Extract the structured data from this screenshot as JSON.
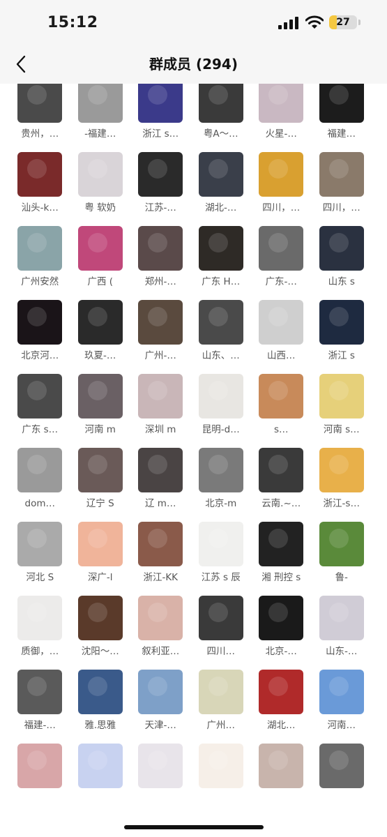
{
  "status_bar": {
    "time": "15:12",
    "battery": "27",
    "battery_level": 0.27,
    "icons": [
      "cellular-signal-icon",
      "wifi-icon",
      "battery-charging-icon"
    ]
  },
  "nav": {
    "title": "群成员 (294)",
    "back_icon": "chevron-left-icon"
  },
  "colors": {
    "nav_bg": "#f6f6f6",
    "name_text": "#555555",
    "battery_fill": "#f5c842"
  },
  "members": [
    {
      "name": "贵州，…",
      "color": "#4a4a4a"
    },
    {
      "name": "-福建…",
      "color": "#9a9a9a"
    },
    {
      "name": "浙江 s…",
      "color": "#3b3a8a"
    },
    {
      "name": "粤A～…",
      "color": "#3a3a3a"
    },
    {
      "name": "火星-…",
      "color": "#c9b8c2"
    },
    {
      "name": "福建…",
      "color": "#1c1c1c"
    },
    {
      "name": "汕头-k…",
      "color": "#7a2a2a"
    },
    {
      "name": "粤 软奶",
      "color": "#d9d4d8"
    },
    {
      "name": "江苏-…",
      "color": "#2a2a2a"
    },
    {
      "name": "湖北-…",
      "color": "#3a3f4a"
    },
    {
      "name": "四川，…",
      "color": "#d9a030"
    },
    {
      "name": "四川，…",
      "color": "#8a7a6a"
    },
    {
      "name": "广州安然",
      "color": "#8aa4a8"
    },
    {
      "name": "广西 (",
      "color": "#c0487a"
    },
    {
      "name": "郑州-…",
      "color": "#5a4a4a"
    },
    {
      "name": "广东 H…",
      "color": "#2e2a26"
    },
    {
      "name": "广东-…",
      "color": "#6a6a6a"
    },
    {
      "name": "山东 s",
      "color": "#2a3140"
    },
    {
      "name": "北京河…",
      "color": "#1a1418"
    },
    {
      "name": "玖夏-…",
      "color": "#2a2a2a"
    },
    {
      "name": "广州-…",
      "color": "#5a4a3e"
    },
    {
      "name": "山东、…",
      "color": "#4a4a4a"
    },
    {
      "name": "山西…",
      "color": "#cfcfcf"
    },
    {
      "name": "浙江 s",
      "color": "#1e2a40"
    },
    {
      "name": "广东 s…",
      "color": "#4a4a4a"
    },
    {
      "name": "河南 m",
      "color": "#6a6064"
    },
    {
      "name": "深圳 m",
      "color": "#c9b6b8"
    },
    {
      "name": "昆明-d…",
      "color": "#e8e6e2"
    },
    {
      "name": "s…",
      "color": "#c88a5a"
    },
    {
      "name": "河南 s…",
      "color": "#e6d07a"
    },
    {
      "name": "dom…",
      "color": "#9a9a9a"
    },
    {
      "name": "辽宁 S",
      "color": "#6a5a58"
    },
    {
      "name": "辽 m…",
      "color": "#4a4444"
    },
    {
      "name": "北京-m",
      "color": "#7a7a7a"
    },
    {
      "name": "云南.~…",
      "color": "#3a3a3a"
    },
    {
      "name": "浙江-s…",
      "color": "#e8b04a"
    },
    {
      "name": "河北 S",
      "color": "#aaaaaa"
    },
    {
      "name": "深广-l",
      "color": "#f0b49a"
    },
    {
      "name": "浙江-KK",
      "color": "#8a5a4a"
    },
    {
      "name": "江苏 s 辰",
      "color": "#f0f0ee"
    },
    {
      "name": "湘 刑控 s",
      "color": "#222222"
    },
    {
      "name": "鲁-",
      "color": "#5a8a3a"
    },
    {
      "name": "质御，…",
      "color": "#ecebea"
    },
    {
      "name": "沈阳～…",
      "color": "#5a3a2a"
    },
    {
      "name": "叙利亚…",
      "color": "#d9b2a8"
    },
    {
      "name": "四川…",
      "color": "#3a3a3a"
    },
    {
      "name": "北京-…",
      "color": "#1a1a1a"
    },
    {
      "name": "山东-…",
      "color": "#d0ccd6"
    },
    {
      "name": "福建-…",
      "color": "#5a5a5a"
    },
    {
      "name": "雅.思雅",
      "color": "#3a5a8a"
    },
    {
      "name": "天津-…",
      "color": "#7ea0c8"
    },
    {
      "name": "广州…",
      "color": "#d8d6b8"
    },
    {
      "name": "湖北…",
      "color": "#b02a2a"
    },
    {
      "name": "河南…",
      "color": "#6a9ad8"
    },
    {
      "name": "",
      "color": "#d8a6a8"
    },
    {
      "name": "",
      "color": "#c8d2f0"
    },
    {
      "name": "",
      "color": "#e8e4ea"
    },
    {
      "name": "",
      "color": "#f6efe8"
    },
    {
      "name": "",
      "color": "#c8b4ac"
    },
    {
      "name": "",
      "color": "#6a6a6a"
    }
  ]
}
